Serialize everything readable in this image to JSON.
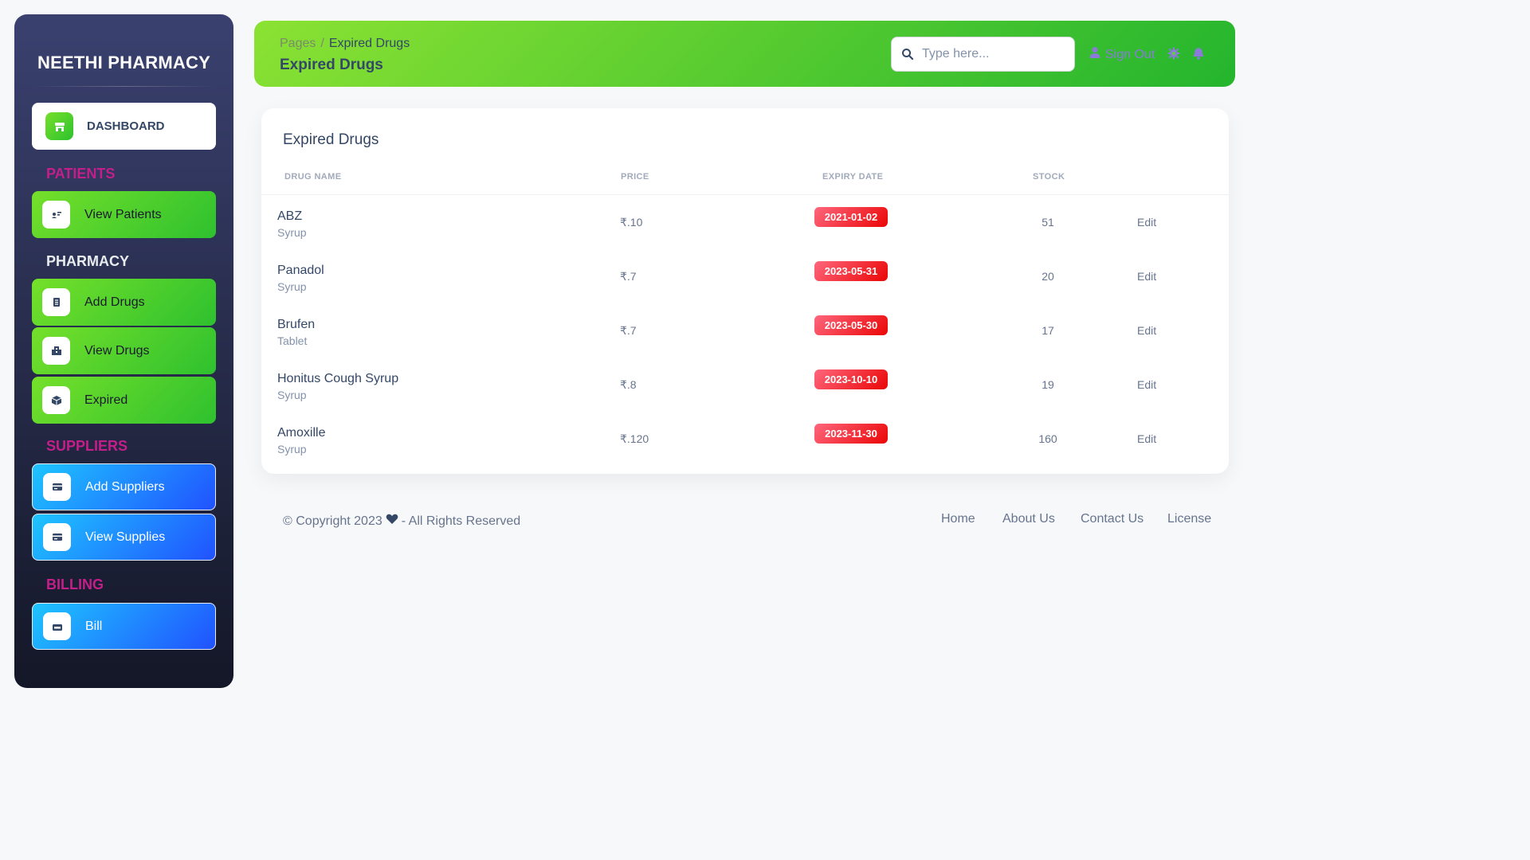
{
  "sidebar": {
    "brand": "NEETHI PHARMACY",
    "dashboard_label": "DASHBOARD",
    "sections": {
      "patients": "PATIENTS",
      "pharmacy": "PHARMACY",
      "suppliers": "SUPPLIERS",
      "billing": "BILLING"
    },
    "items": {
      "view_patients": "View Patients",
      "add_drugs": "Add Drugs",
      "view_drugs": "View Drugs",
      "expired": "Expired",
      "add_suppliers": "Add Suppliers",
      "view_supplies": "View Supplies",
      "bill": "Bill"
    }
  },
  "header": {
    "breadcrumb_root": "Pages",
    "breadcrumb_sep": "/",
    "breadcrumb_current": "Expired Drugs",
    "title": "Expired Drugs",
    "search_placeholder": "Type here...",
    "signout_label": "Sign Out"
  },
  "card": {
    "title": "Expired Drugs",
    "columns": [
      "DRUG NAME",
      "PRICE",
      "EXPIRY DATE",
      "STOCK"
    ],
    "rows": [
      {
        "name": "ABZ",
        "type": "Syrup",
        "price": "₹.10",
        "expiry": "2021-01-02",
        "stock": "51",
        "action": "Edit"
      },
      {
        "name": "Panadol",
        "type": "Syrup",
        "price": "₹.7",
        "expiry": "2023-05-31",
        "stock": "20",
        "action": "Edit"
      },
      {
        "name": "Brufen",
        "type": "Tablet",
        "price": "₹.7",
        "expiry": "2023-05-30",
        "stock": "17",
        "action": "Edit"
      },
      {
        "name": "Honitus Cough Syrup",
        "type": "Syrup",
        "price": "₹.8",
        "expiry": "2023-10-10",
        "stock": "19",
        "action": "Edit"
      },
      {
        "name": "Amoxille",
        "type": "Syrup",
        "price": "₹.120",
        "expiry": "2023-11-30",
        "stock": "160",
        "action": "Edit"
      }
    ]
  },
  "footer": {
    "copyright_pre": "© Copyright 2023",
    "copyright_post": "- All Rights Reserved",
    "links": [
      "Home",
      "About Us",
      "Contact Us",
      "License"
    ]
  },
  "colors": {
    "accent_green": "#2ec12f",
    "accent_blue": "#2152ff",
    "badge_red": "#ea0606",
    "section_pink": "#c41e8a"
  }
}
